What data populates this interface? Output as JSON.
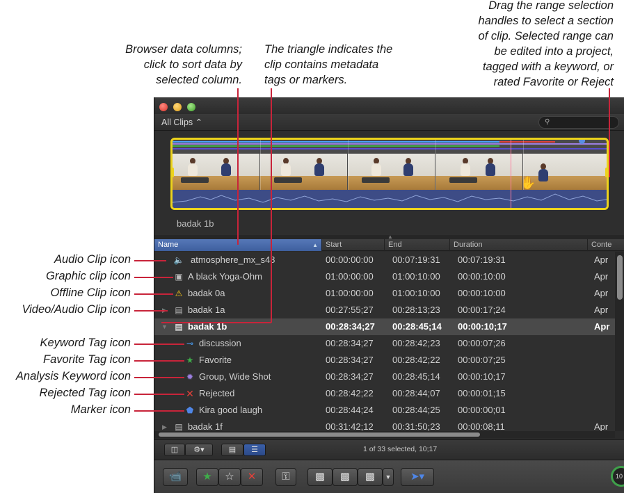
{
  "callouts": {
    "browser_columns": [
      "Browser data columns;",
      "click to sort data by",
      "selected column."
    ],
    "triangle": [
      "The triangle indicates the",
      "clip contains metadata",
      "tags or markers."
    ],
    "range": [
      "Drag the range selection",
      "handles to select a section",
      "of clip. Selected range can",
      "be edited into a project,",
      "tagged with a keyword, or",
      "rated Favorite or Reject"
    ]
  },
  "side_labels": {
    "audio_clip": "Audio Clip icon",
    "graphic_clip": "Graphic clip icon",
    "offline_clip": "Offline Clip icon",
    "video_audio_clip": "Video/Audio Clip icon",
    "keyword_tag": "Keyword Tag icon",
    "favorite_tag": "Favorite Tag icon",
    "analysis_keyword": "Analysis Keyword icon",
    "rejected_tag": "Rejected Tag icon",
    "marker": "Marker icon"
  },
  "app": {
    "clips_filter": "All Clips ⌃",
    "filmstrip_caption": "badak 1b",
    "columns": {
      "name": "Name",
      "start": "Start",
      "end": "End",
      "duration": "Duration",
      "content": "Conte"
    },
    "rows": [
      {
        "name": "atmosphere_mx_s48",
        "start": "00:00:00:00",
        "end": "00:07:19:31",
        "duration": "00:07:19:31",
        "content": "Apr"
      },
      {
        "name": "A black Yoga-Ohm",
        "start": "01:00:00:00",
        "end": "01:00:10:00",
        "duration": "00:00:10:00",
        "content": "Apr"
      },
      {
        "name": "badak 0a",
        "start": "01:00:00:00",
        "end": "01:00:10:00",
        "duration": "00:00:10:00",
        "content": "Apr"
      },
      {
        "name": "badak 1a",
        "start": "00:27:55;27",
        "end": "00:28:13;23",
        "duration": "00:00:17;24",
        "content": "Apr"
      },
      {
        "name": "badak 1b",
        "start": "00:28:34;27",
        "end": "00:28:45;14",
        "duration": "00:00:10;17",
        "content": "Apr"
      },
      {
        "name": "discussion",
        "start": "00:28:34;27",
        "end": "00:28:42;23",
        "duration": "00:00:07;26",
        "content": ""
      },
      {
        "name": "Favorite",
        "start": "00:28:34;27",
        "end": "00:28:42;22",
        "duration": "00:00:07;25",
        "content": ""
      },
      {
        "name": "Group, Wide Shot",
        "start": "00:28:34;27",
        "end": "00:28:45;14",
        "duration": "00:00:10;17",
        "content": ""
      },
      {
        "name": "Rejected",
        "start": "00:28:42;22",
        "end": "00:28:44;07",
        "duration": "00:00:01;15",
        "content": ""
      },
      {
        "name": "Kira good laugh",
        "start": "00:28:44;24",
        "end": "00:28:44;25",
        "duration": "00:00:00;01",
        "content": ""
      },
      {
        "name": "badak 1f",
        "start": "00:31:42;12",
        "end": "00:31:50;23",
        "duration": "00:00:08;11",
        "content": "Apr"
      }
    ],
    "status": "1 of 33 selected, 10;17",
    "meter_label": "10"
  },
  "colors": {
    "pointer": "#c8243a",
    "selection_border": "#ecd31c",
    "keyword_blue": "#4aa3ff",
    "favorite_green": "#3fae4a",
    "analysis_purple": "#9b7fe0",
    "reject_red": "#e0413a",
    "marker_blue": "#4f86e6"
  },
  "icons": {
    "audio": "speaker-icon",
    "graphic": "image-icon",
    "offline": "warning-icon",
    "video_audio": "filmstrip-icon",
    "keyword": "key-icon",
    "favorite": "star-icon",
    "analysis": "gear-badge-icon",
    "rejected": "x-icon",
    "marker": "marker-icon"
  }
}
